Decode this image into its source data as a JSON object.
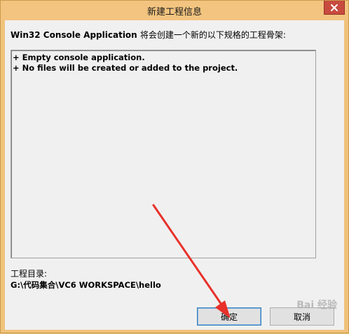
{
  "window": {
    "title": "新建工程信息"
  },
  "intro": {
    "app_name": "Win32 Console Application",
    "description": "将会创建一个新的以下规格的工程骨架:"
  },
  "info_lines": [
    "+ Empty console application.",
    "+ No files will be created or added to the project."
  ],
  "directory": {
    "label": "工程目录:",
    "path": "G:\\代码集合\\VC6 WORKSPACE\\hello"
  },
  "buttons": {
    "ok": "确定",
    "cancel": "取消"
  },
  "watermark": "Bai 经验",
  "colors": {
    "titlebar": "#f2c47f",
    "close_button": "#c74b3f",
    "arrow": "#e8312a"
  },
  "icons": {
    "close": "close-icon"
  }
}
